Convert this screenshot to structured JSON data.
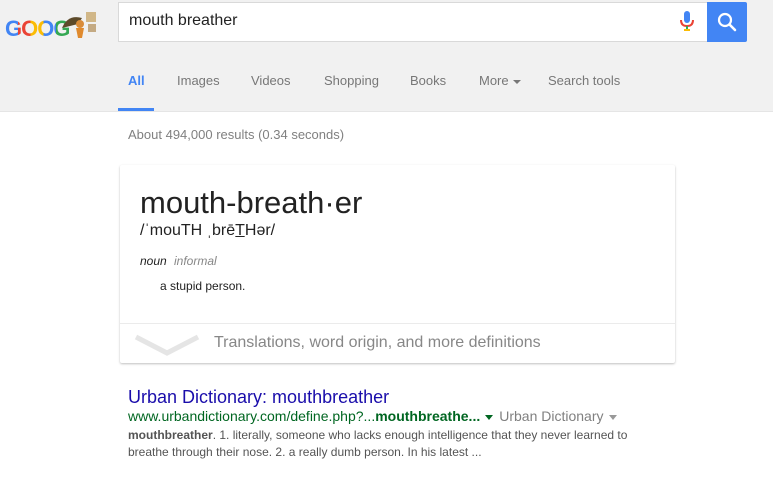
{
  "header": {
    "logo_text": "GOOG",
    "search_query": "mouth breather"
  },
  "colors": {
    "accent": "#4285f4",
    "link": "#1a0dab",
    "url": "#006621"
  },
  "tabs": [
    {
      "label": "All",
      "active": true
    },
    {
      "label": "Images"
    },
    {
      "label": "Videos"
    },
    {
      "label": "Shopping"
    },
    {
      "label": "Books"
    },
    {
      "label": "More"
    },
    {
      "label": "Search tools"
    }
  ],
  "stats": "About 494,000 results (0.34 seconds)",
  "definition_card": {
    "headword": "mouth-breath·er",
    "pronunciation": "/ˈmouTH ˌbrēT̲Hər/",
    "part_of_speech": "noun",
    "register": "informal",
    "definition": "a stupid person.",
    "more_link": "Translations, word origin, and more definitions"
  },
  "results": [
    {
      "title": "Urban Dictionary: mouthbreather",
      "url_prefix": "www.urbandictionary.com/define.php?...",
      "url_bold": "mouthbreathe...",
      "source": "Urban Dictionary",
      "snippet_bold": "mouthbreather",
      "snippet": ". 1. literally, someone who lacks enough intelligence that they never learned to breathe through their nose. 2. a really dumb person. In his latest ..."
    }
  ]
}
